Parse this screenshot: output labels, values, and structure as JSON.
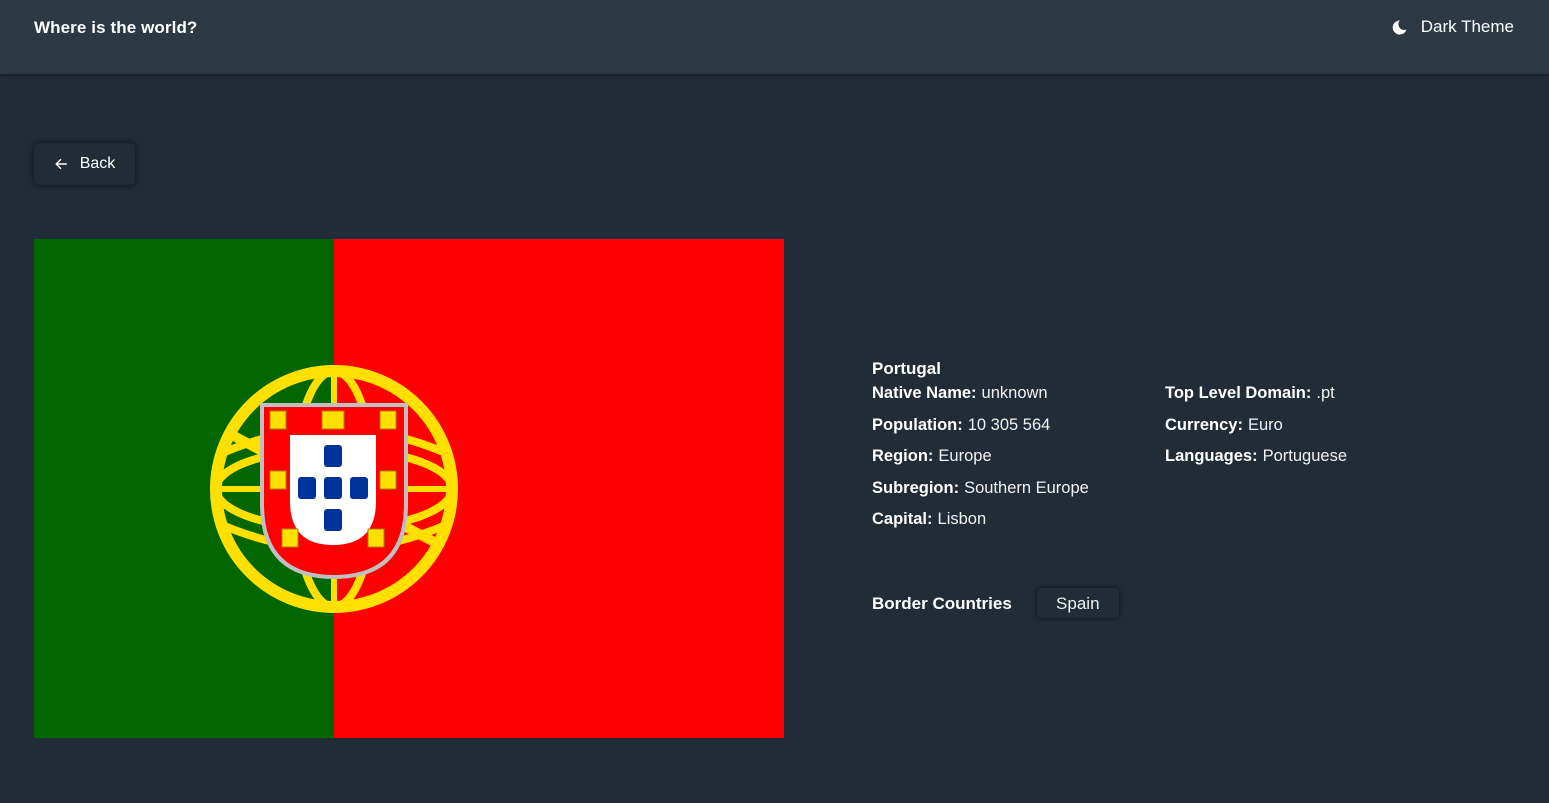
{
  "header": {
    "brand": "Where is the world?",
    "theme_label": "Dark Theme",
    "theme_icon": "moon-icon"
  },
  "back": {
    "label": "Back",
    "icon": "arrow-left-icon"
  },
  "country": {
    "name": "Portugal",
    "flag": {
      "green": "#006600",
      "red": "#ff0000",
      "yellow": "#ffe000",
      "blue": "#003399"
    },
    "left_fields": [
      {
        "key": "Native Name:",
        "value": "unknown"
      },
      {
        "key": "Population:",
        "value": "10 305 564"
      },
      {
        "key": "Region:",
        "value": "Europe"
      },
      {
        "key": "Subregion:",
        "value": "Southern Europe"
      },
      {
        "key": "Capital:",
        "value": "Lisbon"
      }
    ],
    "right_fields": [
      {
        "key": "Top Level Domain:",
        "value": ".pt"
      },
      {
        "key": "Currency:",
        "value": "Euro"
      },
      {
        "key": "Languages:",
        "value": "Portuguese"
      }
    ],
    "borders_label": "Border Countries",
    "borders": [
      "Spain"
    ]
  },
  "colors": {
    "background": "#202c37",
    "element": "#2b3945",
    "text": "#ffffff"
  }
}
